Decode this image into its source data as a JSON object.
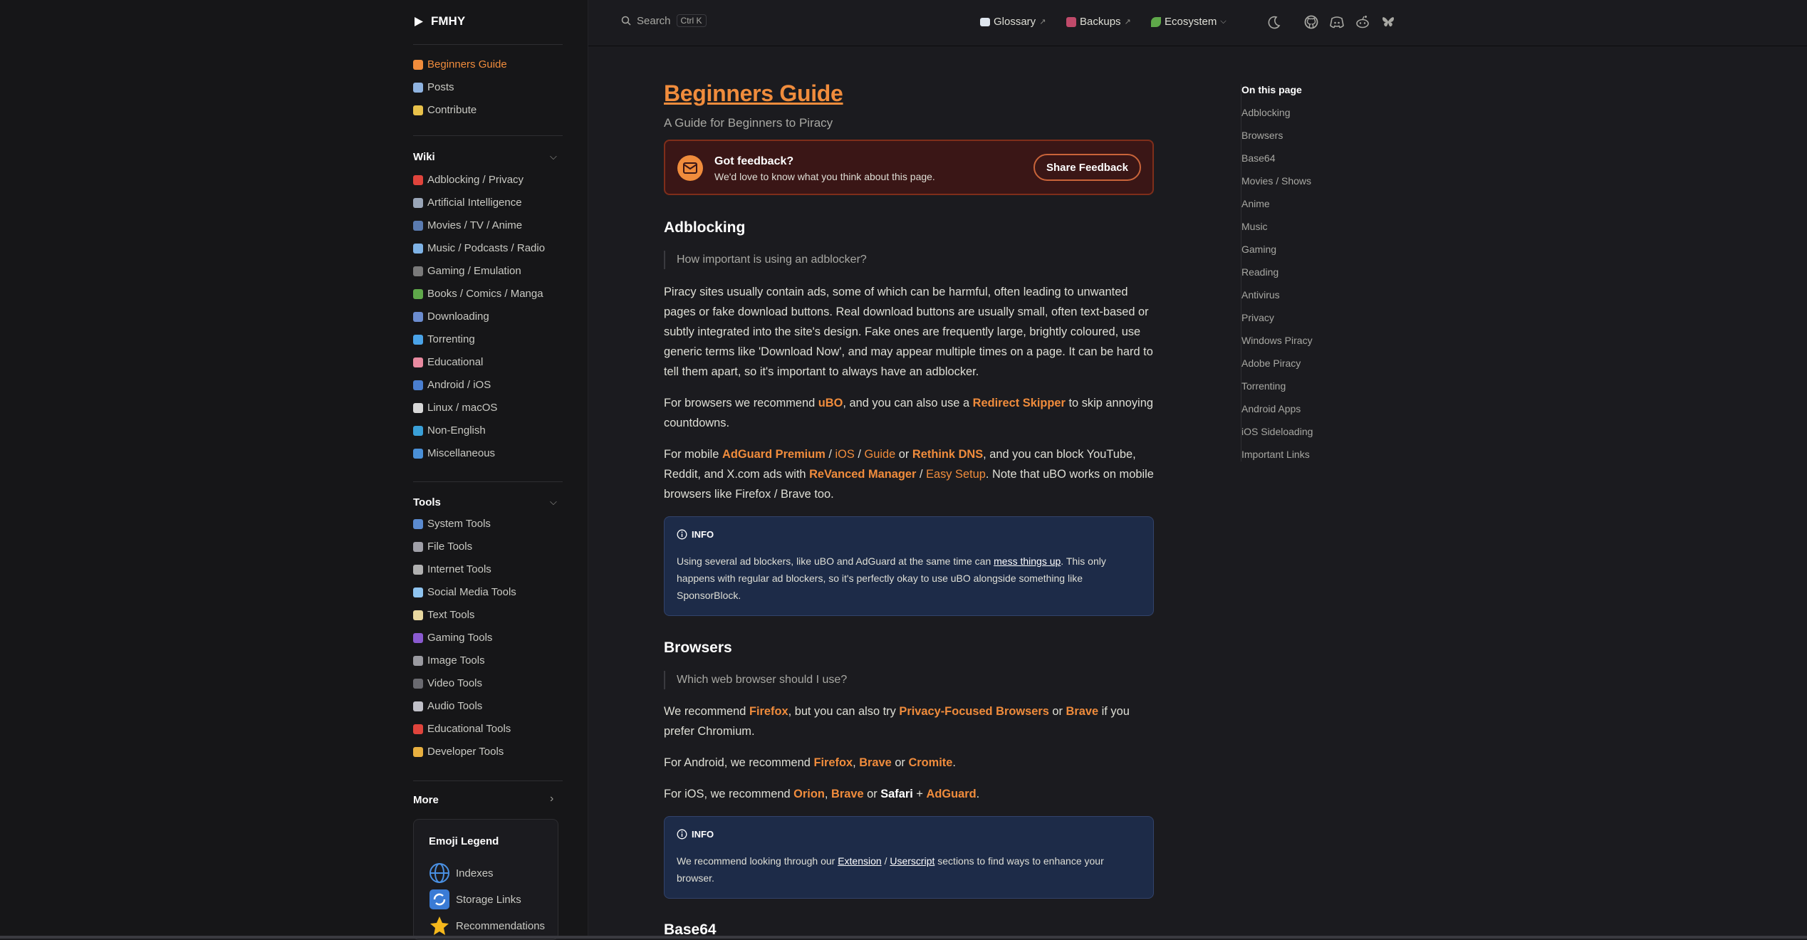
{
  "brand": {
    "name": "FMHY"
  },
  "search": {
    "label": "Search",
    "shortcut": "Ctrl K"
  },
  "topnav": [
    {
      "label": "Glossary",
      "external": "↗"
    },
    {
      "label": "Backups",
      "external": "↗"
    },
    {
      "label": "Ecosystem",
      "external": ""
    }
  ],
  "sidebar": {
    "top_items": [
      {
        "label": "Beginners Guide",
        "active": true,
        "color": "#f08c3c"
      },
      {
        "label": "Posts",
        "color": "#8fb3e0"
      },
      {
        "label": "Contribute",
        "color": "#e8c14a"
      }
    ],
    "wiki_title": "Wiki",
    "wiki_items": [
      {
        "label": "Adblocking / Privacy",
        "color": "#e0443c"
      },
      {
        "label": "Artificial Intelligence",
        "color": "#9aa6b8"
      },
      {
        "label": "Movies / TV / Anime",
        "color": "#5a7bb0"
      },
      {
        "label": "Music / Podcasts / Radio",
        "color": "#7fb3e6"
      },
      {
        "label": "Gaming / Emulation",
        "color": "#7a7a7a"
      },
      {
        "label": "Books / Comics / Manga",
        "color": "#5fa84a"
      },
      {
        "label": "Downloading",
        "color": "#6b8ccf"
      },
      {
        "label": "Torrenting",
        "color": "#4aa3e8"
      },
      {
        "label": "Educational",
        "color": "#e88aa0"
      },
      {
        "label": "Android / iOS",
        "color": "#4a7fd0"
      },
      {
        "label": "Linux / macOS",
        "color": "#d8d8d8"
      },
      {
        "label": "Non-English",
        "color": "#3aa0d8"
      },
      {
        "label": "Miscellaneous",
        "color": "#4a90d8"
      }
    ],
    "tools_title": "Tools",
    "tools_items": [
      {
        "label": "System Tools",
        "color": "#5b8bd0"
      },
      {
        "label": "File Tools",
        "color": "#a0a0a8"
      },
      {
        "label": "Internet Tools",
        "color": "#b0b0b0"
      },
      {
        "label": "Social Media Tools",
        "color": "#8fc4f0"
      },
      {
        "label": "Text Tools",
        "color": "#e8d8a0"
      },
      {
        "label": "Gaming Tools",
        "color": "#8a5ad0"
      },
      {
        "label": "Image Tools",
        "color": "#9a9aa0"
      },
      {
        "label": "Video Tools",
        "color": "#6a6a70"
      },
      {
        "label": "Audio Tools",
        "color": "#c0c0c8"
      },
      {
        "label": "Educational Tools",
        "color": "#e0443c"
      },
      {
        "label": "Developer Tools",
        "color": "#e8b040"
      }
    ],
    "more_title": "More",
    "legend": {
      "title": "Emoji Legend",
      "items": [
        {
          "label": "Indexes",
          "icon": "globe-icon"
        },
        {
          "label": "Storage Links",
          "icon": "refresh-icon"
        },
        {
          "label": "Recommendations",
          "icon": "star-icon"
        }
      ]
    }
  },
  "content": {
    "title": "Beginners Guide",
    "subtitle": "A Guide for Beginners to Piracy",
    "feedback": {
      "title": "Got feedback?",
      "desc": "We'd love to know what you think about this page.",
      "button": "Share Feedback"
    },
    "adblocking": {
      "heading": "Adblocking",
      "question": "How important is using an adblocker?",
      "p1": "Piracy sites usually contain ads, some of which can be harmful, often leading to unwanted pages or fake download buttons. Real download buttons are usually small, often text-based or subtly integrated into the site's design. Fake ones are frequently large, brightly coloured, use generic terms like 'Download Now', and may appear multiple times on a page. It can be hard to tell them apart, so it's important to always have an adblocker.",
      "p2": {
        "t1": "For browsers we recommend ",
        "l1": "uBO",
        "t2": ", and you can also use a ",
        "l2": "Redirect Skipper",
        "t3": " to skip annoying countdowns."
      },
      "p3": {
        "t1": "For mobile ",
        "l1": "AdGuard Premium",
        "s1": " / ",
        "l2": "iOS",
        "s2": " / ",
        "l3": "Guide",
        "t2": " or ",
        "l4": "Rethink DNS",
        "t3": ", and you can block YouTube, Reddit, and X.com ads with ",
        "l5": "ReVanced Manager",
        "s3": " / ",
        "l6": "Easy Setup",
        "t4": ". Note that uBO works on mobile browsers like Firefox / Brave too."
      },
      "info": {
        "label": "INFO",
        "t1": "Using several ad blockers, like uBO and AdGuard at the same time can ",
        "link": "mess things up",
        "t2": ". This only happens with regular ad blockers, so it's perfectly okay to use uBO alongside something like SponsorBlock."
      }
    },
    "browsers": {
      "heading": "Browsers",
      "question": "Which web browser should I use?",
      "p1": {
        "t1": "We recommend ",
        "l1": "Firefox",
        "t2": ", but you can also try ",
        "l2": "Privacy-Focused Browsers",
        "t3": " or ",
        "l3": "Brave",
        "t4": " if you prefer Chromium."
      },
      "p2": {
        "t1": "For Android, we recommend ",
        "l1": "Firefox",
        "s1": ", ",
        "l2": "Brave",
        "t2": " or ",
        "l3": "Cromite",
        "t3": "."
      },
      "p3": {
        "t1": "For iOS, we recommend ",
        "l1": "Orion",
        "s1": ", ",
        "l2": "Brave",
        "t2": " or ",
        "b1": "Safari",
        "s2": " + ",
        "l3": "AdGuard",
        "t3": "."
      },
      "info": {
        "label": "INFO",
        "t1": "We recommend looking through our ",
        "link1": "Extension",
        "s1": " / ",
        "link2": "Userscript",
        "t2": " sections to find ways to enhance your browser."
      }
    },
    "base64": {
      "heading": "Base64"
    }
  },
  "toc": {
    "title": "On this page",
    "items": [
      "Adblocking",
      "Browsers",
      "Base64",
      "Movies / Shows",
      "Anime",
      "Music",
      "Gaming",
      "Reading",
      "Antivirus",
      "Privacy",
      "Windows Piracy",
      "Adobe Piracy",
      "Torrenting",
      "Android Apps",
      "iOS Sideloading",
      "Important Links"
    ]
  }
}
